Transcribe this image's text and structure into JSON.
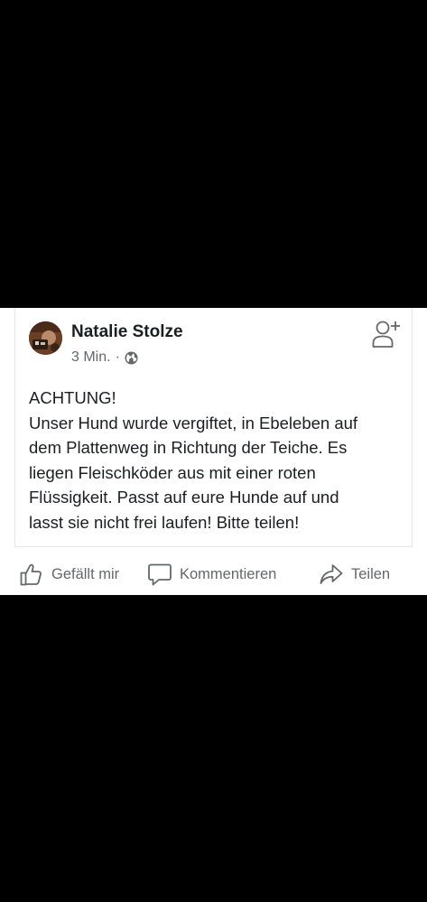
{
  "post": {
    "author": "Natalie Stolze",
    "time": "3 Min.",
    "separator": "·",
    "privacy_icon": "globe-icon",
    "header_action_icon": "add-friend-icon",
    "text_lines": [
      "ACHTUNG!",
      "Unser Hund wurde vergiftet, in Ebeleben auf",
      "dem Plattenweg in Richtung der Teiche. Es",
      "liegen Fleischköder aus mit einer roten",
      "Flüssigkeit. Passt auf eure Hunde auf und",
      "lasst sie nicht frei laufen! Bitte teilen!"
    ]
  },
  "actions": {
    "like": "Gefällt mir",
    "comment": "Kommentieren",
    "share": "Teilen"
  },
  "colors": {
    "background": "#000000",
    "card": "#ffffff",
    "text": "#1c1e21",
    "secondary_text": "#65676b",
    "divider": "#e4e6eb"
  }
}
